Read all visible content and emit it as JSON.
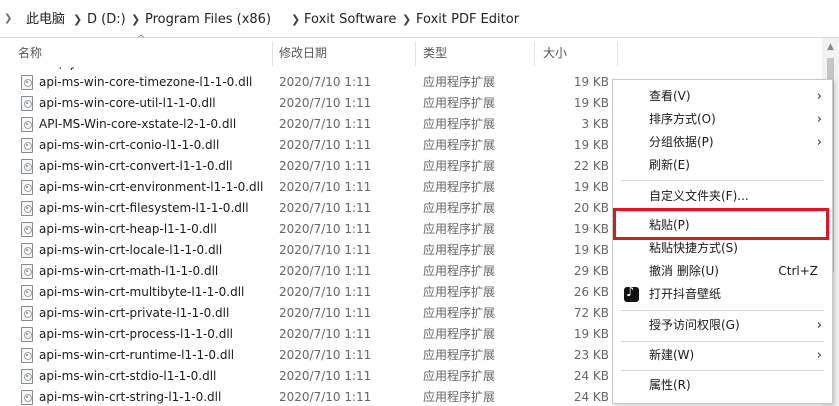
{
  "breadcrumb": {
    "items": [
      "此电脑",
      "D (D:)",
      "Program Files (x86)",
      "Foxit Software",
      "Foxit PDF Editor"
    ]
  },
  "columns": {
    "name": "名称",
    "date": "修改日期",
    "type": "类型",
    "size": "大小"
  },
  "files": [
    {
      "name": "api-ms-win-core-timezone-l1-1-0.dll",
      "date": "2020/7/10 1:11",
      "type": "应用程序扩展",
      "size": "19 KB"
    },
    {
      "name": "api-ms-win-core-util-l1-1-0.dll",
      "date": "2020/7/10 1:11",
      "type": "应用程序扩展",
      "size": "19 KB"
    },
    {
      "name": "API-MS-Win-core-xstate-l2-1-0.dll",
      "date": "2020/7/10 1:11",
      "type": "应用程序扩展",
      "size": "3 KB"
    },
    {
      "name": "api-ms-win-crt-conio-l1-1-0.dll",
      "date": "2020/7/10 1:11",
      "type": "应用程序扩展",
      "size": "19 KB"
    },
    {
      "name": "api-ms-win-crt-convert-l1-1-0.dll",
      "date": "2020/7/10 1:11",
      "type": "应用程序扩展",
      "size": "22 KB"
    },
    {
      "name": "api-ms-win-crt-environment-l1-1-0.dll",
      "date": "2020/7/10 1:11",
      "type": "应用程序扩展",
      "size": "19 KB"
    },
    {
      "name": "api-ms-win-crt-filesystem-l1-1-0.dll",
      "date": "2020/7/10 1:11",
      "type": "应用程序扩展",
      "size": "20 KB"
    },
    {
      "name": "api-ms-win-crt-heap-l1-1-0.dll",
      "date": "2020/7/10 1:11",
      "type": "应用程序扩展",
      "size": "19 KB"
    },
    {
      "name": "api-ms-win-crt-locale-l1-1-0.dll",
      "date": "2020/7/10 1:11",
      "type": "应用程序扩展",
      "size": "19 KB"
    },
    {
      "name": "api-ms-win-crt-math-l1-1-0.dll",
      "date": "2020/7/10 1:11",
      "type": "应用程序扩展",
      "size": "29 KB"
    },
    {
      "name": "api-ms-win-crt-multibyte-l1-1-0.dll",
      "date": "2020/7/10 1:11",
      "type": "应用程序扩展",
      "size": "26 KB"
    },
    {
      "name": "api-ms-win-crt-private-l1-1-0.dll",
      "date": "2020/7/10 1:11",
      "type": "应用程序扩展",
      "size": "72 KB"
    },
    {
      "name": "api-ms-win-crt-process-l1-1-0.dll",
      "date": "2020/7/10 1:11",
      "type": "应用程序扩展",
      "size": "19 KB"
    },
    {
      "name": "api-ms-win-crt-runtime-l1-1-0.dll",
      "date": "2020/7/10 1:11",
      "type": "应用程序扩展",
      "size": "23 KB"
    },
    {
      "name": "api-ms-win-crt-stdio-l1-1-0.dll",
      "date": "2020/7/10 1:11",
      "type": "应用程序扩展",
      "size": "24 KB"
    },
    {
      "name": "api-ms-win-crt-string-l1-1-0.dll",
      "date": "2020/7/10 1:11",
      "type": "应用程序扩展",
      "size": "24 KB"
    }
  ],
  "context_menu": {
    "view": "查看(V)",
    "sort": "排序方式(O)",
    "group": "分组依据(P)",
    "refresh": "刷新(E)",
    "customize": "自定义文件夹(F)...",
    "paste": "粘贴(P)",
    "paste_shortcut": "粘贴快捷方式(S)",
    "undo_delete": "撤消 删除(U)",
    "undo_shortcut": "Ctrl+Z",
    "tiktok": "打开抖音壁纸",
    "grant_access": "授予访问权限(G)",
    "new": "新建(W)",
    "properties": "属性(R)"
  },
  "colors": {
    "highlight_border": "#d71920"
  }
}
